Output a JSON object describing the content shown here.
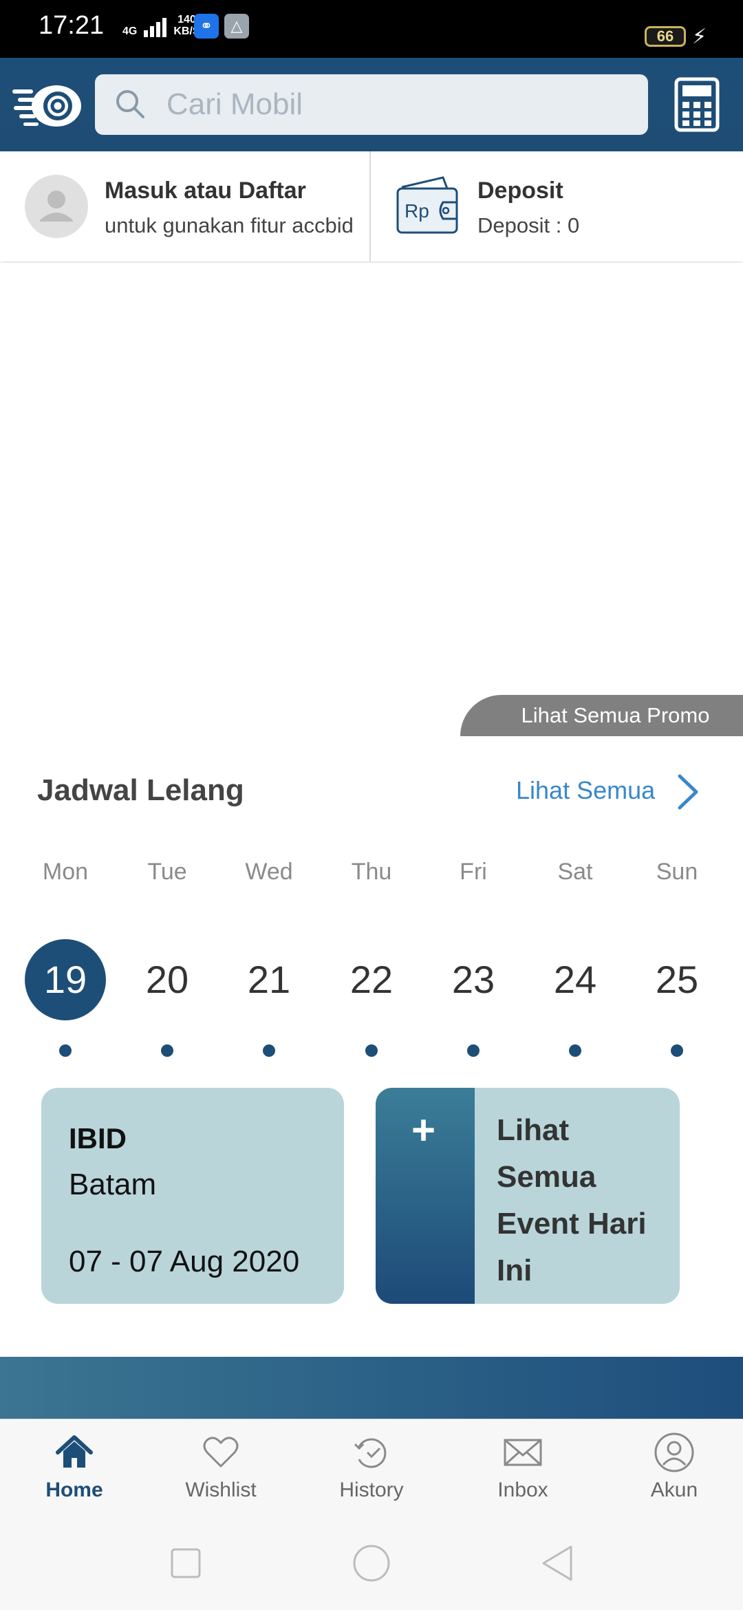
{
  "status_bar": {
    "time": "17:21",
    "network": "4G",
    "speed_value": "140",
    "speed_unit": "KB/S",
    "battery": "66"
  },
  "header": {
    "search_placeholder": "Cari Mobil"
  },
  "account": {
    "login_title": "Masuk atau Daftar",
    "login_subtitle": "untuk gunakan fitur accbid",
    "deposit_title": "Deposit",
    "deposit_value": "Deposit : 0"
  },
  "promo": {
    "see_all_label": "Lihat Semua Promo"
  },
  "schedule": {
    "title": "Jadwal Lelang",
    "see_all_label": "Lihat Semua",
    "weekdays": [
      "Mon",
      "Tue",
      "Wed",
      "Thu",
      "Fri",
      "Sat",
      "Sun"
    ],
    "dates": [
      "19",
      "20",
      "21",
      "22",
      "23",
      "24",
      "25"
    ],
    "selected_date": "19"
  },
  "events": {
    "card": {
      "organizer": "IBID",
      "location": "Batam",
      "date_range": "07 - 07 Aug 2020"
    },
    "see_all_today": "Lihat Semua Event Hari Ini"
  },
  "bottom_nav": {
    "items": [
      {
        "label": "Home",
        "icon": "home-icon",
        "active": true
      },
      {
        "label": "Wishlist",
        "icon": "heart-icon",
        "active": false
      },
      {
        "label": "History",
        "icon": "history-icon",
        "active": false
      },
      {
        "label": "Inbox",
        "icon": "mail-icon",
        "active": false
      },
      {
        "label": "Akun",
        "icon": "user-icon",
        "active": false
      }
    ]
  },
  "colors": {
    "primary": "#1d4e78",
    "link": "#3a87c9",
    "card_bg": "#b9d5da"
  }
}
